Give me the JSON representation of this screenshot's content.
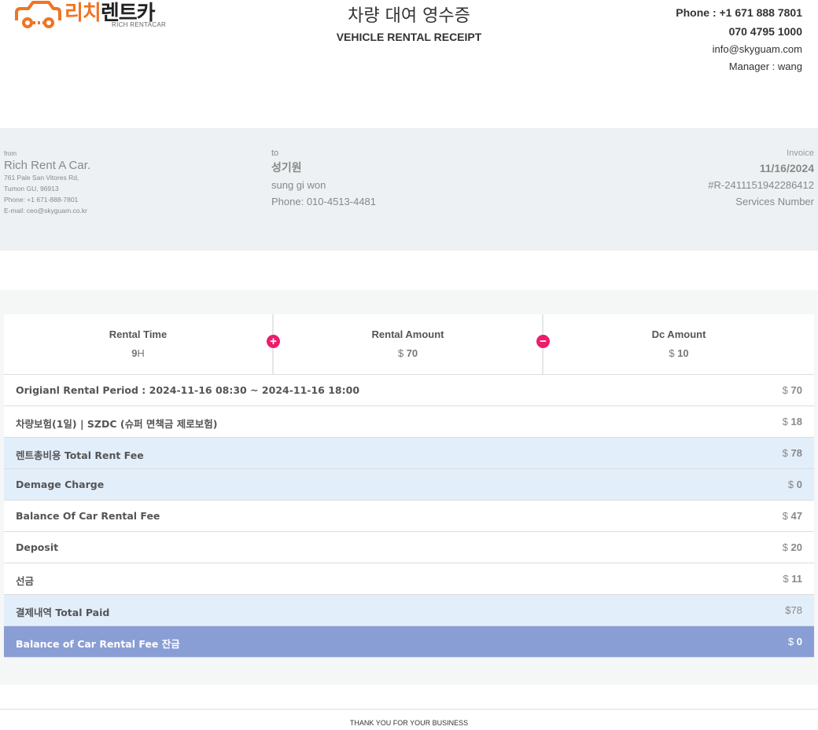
{
  "brand": {
    "name_orange": "리치",
    "name_dark": "렌트카",
    "sub": "RICH RENTACAR",
    "accent_color": "#f07424"
  },
  "header": {
    "title_ko": "차량 대여 영수증",
    "title_en": "VEHICLE RENTAL RECEIPT",
    "phone_label": "Phone : +1 671 888 7801",
    "phone2": "070 4795 1000",
    "email": "info@skyguam.com",
    "manager": "Manager : wang"
  },
  "from": {
    "label": "from",
    "name": "Rich Rent A Car.",
    "address1": "761 Pale San Vitores Rd,",
    "address2": "Tumon GU, 96913",
    "phone": "Phone: +1 671-888-7801",
    "email": "E-mail: ceo@skyguam.co.kr"
  },
  "to": {
    "label": "to",
    "name_ko": "성기원",
    "name_en": "sung gi won",
    "phone": "Phone: 010-4513-4481"
  },
  "invoice": {
    "label": "Invoice",
    "date": "11/16/2024",
    "number": "#R-2411151942286412",
    "services": "Services Number"
  },
  "summary": {
    "rental_time_label": "Rental Time",
    "rental_time_value": "9",
    "rental_time_unit": "H",
    "plus_glyph": "+",
    "rental_amount_label": "Rental Amount",
    "rental_amount_currency": "$",
    "rental_amount_value": "70",
    "minus_glyph": "−",
    "dc_amount_label": "Dc Amount",
    "dc_amount_currency": "$",
    "dc_amount_value": "10"
  },
  "rows": [
    {
      "label": "Origianl Rental Period : 2024-11-16 08:30 ~ 2024-11-16 18:00",
      "cur": "$",
      "amount": "70"
    },
    {
      "label": "차량보험(1일) | SZDC (슈퍼 면책금 제로보험)",
      "cur": "$",
      "amount": "18"
    },
    {
      "label": "렌트총비용 Total Rent Fee",
      "cur": "$",
      "amount": "78"
    },
    {
      "label": "Demage Charge",
      "cur": "$",
      "amount": "0"
    },
    {
      "label": "Balance Of Car Rental Fee",
      "cur": "$",
      "amount": "47"
    },
    {
      "label": "Deposit",
      "cur": "$",
      "amount": "20"
    },
    {
      "label": "선금",
      "cur": "$",
      "amount": "11"
    },
    {
      "label": "결제내역 Total Paid",
      "amount_full": "$78"
    },
    {
      "label": "Balance of Car Rental Fee 잔금",
      "cur": "$",
      "amount": "0"
    }
  ],
  "footer": {
    "text": "THANK YOU FOR YOUR BUSINESS"
  },
  "colors": {
    "op_pink": "#ec1c6c",
    "row_blue": "#e3eefb",
    "row_dark": "#8a9ed6"
  }
}
